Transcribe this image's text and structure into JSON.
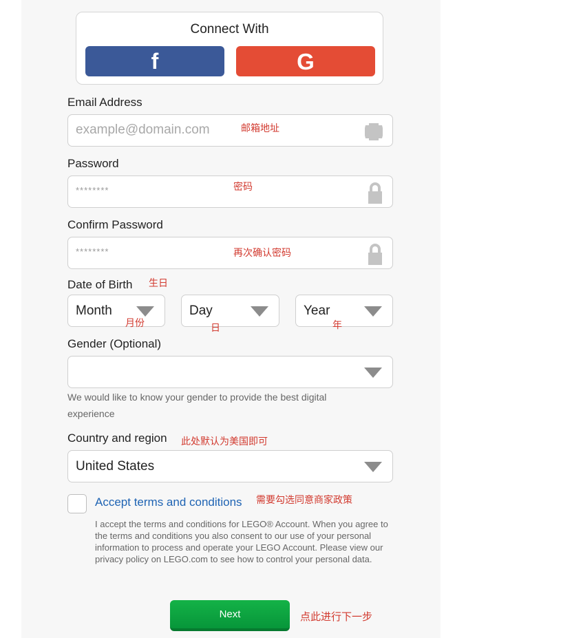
{
  "social": {
    "title": "Connect With",
    "facebook_label": "f",
    "google_label": "G",
    "facebook_color": "#3b5998",
    "google_color": "#e44c35"
  },
  "form": {
    "email": {
      "label": "Email Address",
      "placeholder": "example@domain.com",
      "note": "邮箱地址",
      "icon": "user-head-icon"
    },
    "password": {
      "label": "Password",
      "placeholder": "********",
      "note": "密码",
      "icon": "lock-icon"
    },
    "confirm_password": {
      "label": "Confirm Password",
      "placeholder": "********",
      "note": "再次确认密码",
      "icon": "lock-icon"
    },
    "dob": {
      "label": "Date of Birth",
      "note": "生日",
      "month": "Month",
      "month_note": "月份",
      "day": "Day",
      "day_note": "日",
      "year": "Year",
      "year_note": "年"
    },
    "gender": {
      "label": "Gender (Optional)",
      "value": "",
      "helper": "We would like to know your gender to provide the best digital experience"
    },
    "country": {
      "label": "Country and region",
      "note": "此处默认为美国即可",
      "value": "United States"
    },
    "terms": {
      "checked": false,
      "link": "Accept terms and conditions",
      "note": "需要勾选同意商家政策",
      "body": "I accept the terms and conditions for LEGO® Account. When you agree to the terms and conditions you also consent to our use of your personal information to process and operate your LEGO Account. Please view our privacy policy on LEGO.com to see how to control your personal data."
    },
    "next": {
      "label": "Next",
      "note": "点此进行下一步",
      "color": "#0a9e3e"
    }
  },
  "colors": {
    "annotation": "#d23a2f",
    "link": "#1e63b3"
  }
}
